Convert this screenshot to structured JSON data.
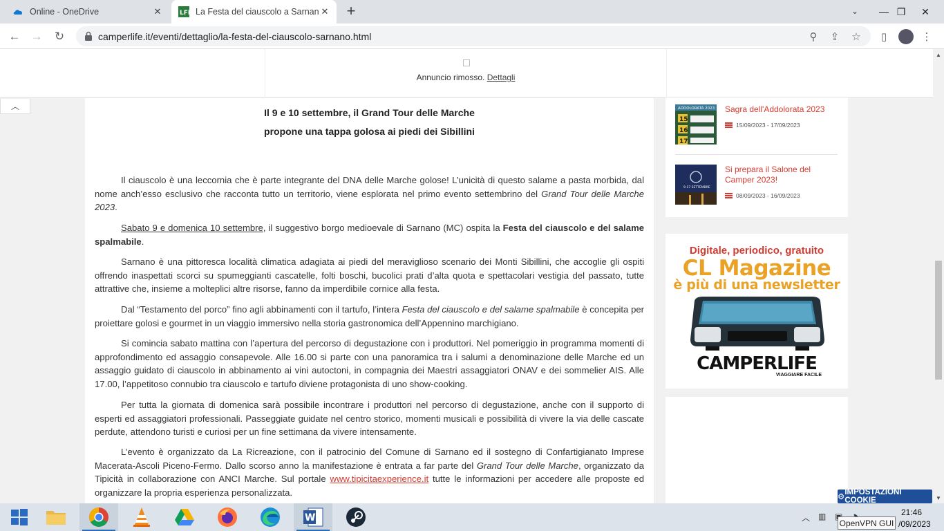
{
  "browser": {
    "tabs": [
      {
        "title": "Online - OneDrive",
        "icon": "onedrive-icon"
      },
      {
        "title": "La Festa del ciauscolo a Sarnano",
        "icon": "camperlife-favicon"
      }
    ],
    "url": "camperlife.it/eventi/dettaglio/la-festa-del-ciauscolo-sarnano.html"
  },
  "ad": {
    "text": "Annuncio rimosso.",
    "link": "Dettagli"
  },
  "article": {
    "headline_line1": "Il 9 e 10 settembre, il Grand Tour delle Marche",
    "headline_line2": "propone una tappa golosa ai piedi dei Sibillini",
    "p1": [
      "Il ciauscolo è una leccornia che è parte integrante del DNA delle Marche golose! L’unicità di questo salame a pasta morbida, dal nome anch’esso esclusivo che racconta tutto un territorio, viene esplorata nel primo evento settembrino del ",
      "Grand Tour delle Marche 2023",
      "."
    ],
    "p2": [
      "Sabato 9 e domenica 10 settembre",
      ", il suggestivo borgo medioevale di Sarnano (MC) ospita la ",
      "Festa del ciauscolo e del salame spalmabile",
      "."
    ],
    "p3": "Sarnano è una pittoresca località climatica adagiata ai piedi del meraviglioso scenario dei Monti Sibillini, che accoglie gli ospiti offrendo inaspettati scorci su spumeggianti cascatelle, folti boschi, bucolici prati d’alta quota e spettacolari vestigia del passato, tutte attrattive che, insieme a molteplici altre risorse, fanno da imperdibile cornice alla festa.",
    "p4": [
      "Dal “Testamento del porco” fino agli abbinamenti con il tartufo, l’intera ",
      "Festa del ciauscolo e del salame spalmabile",
      " è concepita per proiettare golosi e gourmet in un viaggio immersivo nella storia gastronomica dell’Appennino marchigiano."
    ],
    "p5": "Si comincia sabato mattina con l’apertura del percorso di degustazione con i produttori. Nel pomeriggio in programma momenti di approfondimento ed assaggio consapevole. Alle 16.00 si parte con una panoramica tra i salumi a denominazione delle Marche ed un assaggio guidato di ciauscolo in abbinamento ai vini autoctoni, in compagnia dei Maestri assaggiatori ONAV e dei sommelier AIS. Alle 17.00, l’appetitoso connubio tra ciauscolo e tartufo diviene protagonista di uno show-cooking.",
    "p6": "Per tutta la giornata di domenica sarà possibile incontrare i produttori nel percorso di degustazione, anche con il supporto di esperti ed assaggiatori professionali. Passeggiate guidate nel centro storico, momenti musicali e possibilità di vivere la via delle cascate perdute, attendono turisti e curiosi per un fine settimana da vivere intensamente.",
    "p7": [
      "L’evento è organizzato da La Ricreazione, con il patrocinio del Comune di Sarnano ed il sostegno di Confartigianato Imprese Macerata-Ascoli Piceno-Fermo. Dallo scorso anno la manifestazione è entrata a far parte del ",
      "Grand Tour delle Marche",
      ", organizzato da Tipicità in collaborazione con ANCI Marche. Sul portale ",
      "www.tipicitaexperience.it",
      " tutte le informazioni per accedere alle proposte ed organizzare la propria esperienza personalizzata."
    ]
  },
  "sidebar": {
    "events": [
      {
        "title": "Sagra dell'Addolorata 2023",
        "date": "15/09/2023 - 17/09/2023"
      },
      {
        "title": "Si prepara il Salone del Camper 2023!",
        "date": "08/09/2023 - 16/09/2023"
      }
    ],
    "magazine": {
      "line1": "Digitale, periodico, gratuito",
      "line2": "CL Magazine",
      "line3": "è più di una newsletter",
      "brand": "CAMPERLIFE",
      "tagline": "VIAGGIARE FACILE"
    }
  },
  "cookie_button": "IMPOSTAZIONI COOKIE",
  "taskbar": {
    "time": "21:46",
    "date": "/09/2023",
    "tooltip": "OpenVPN GUI"
  }
}
